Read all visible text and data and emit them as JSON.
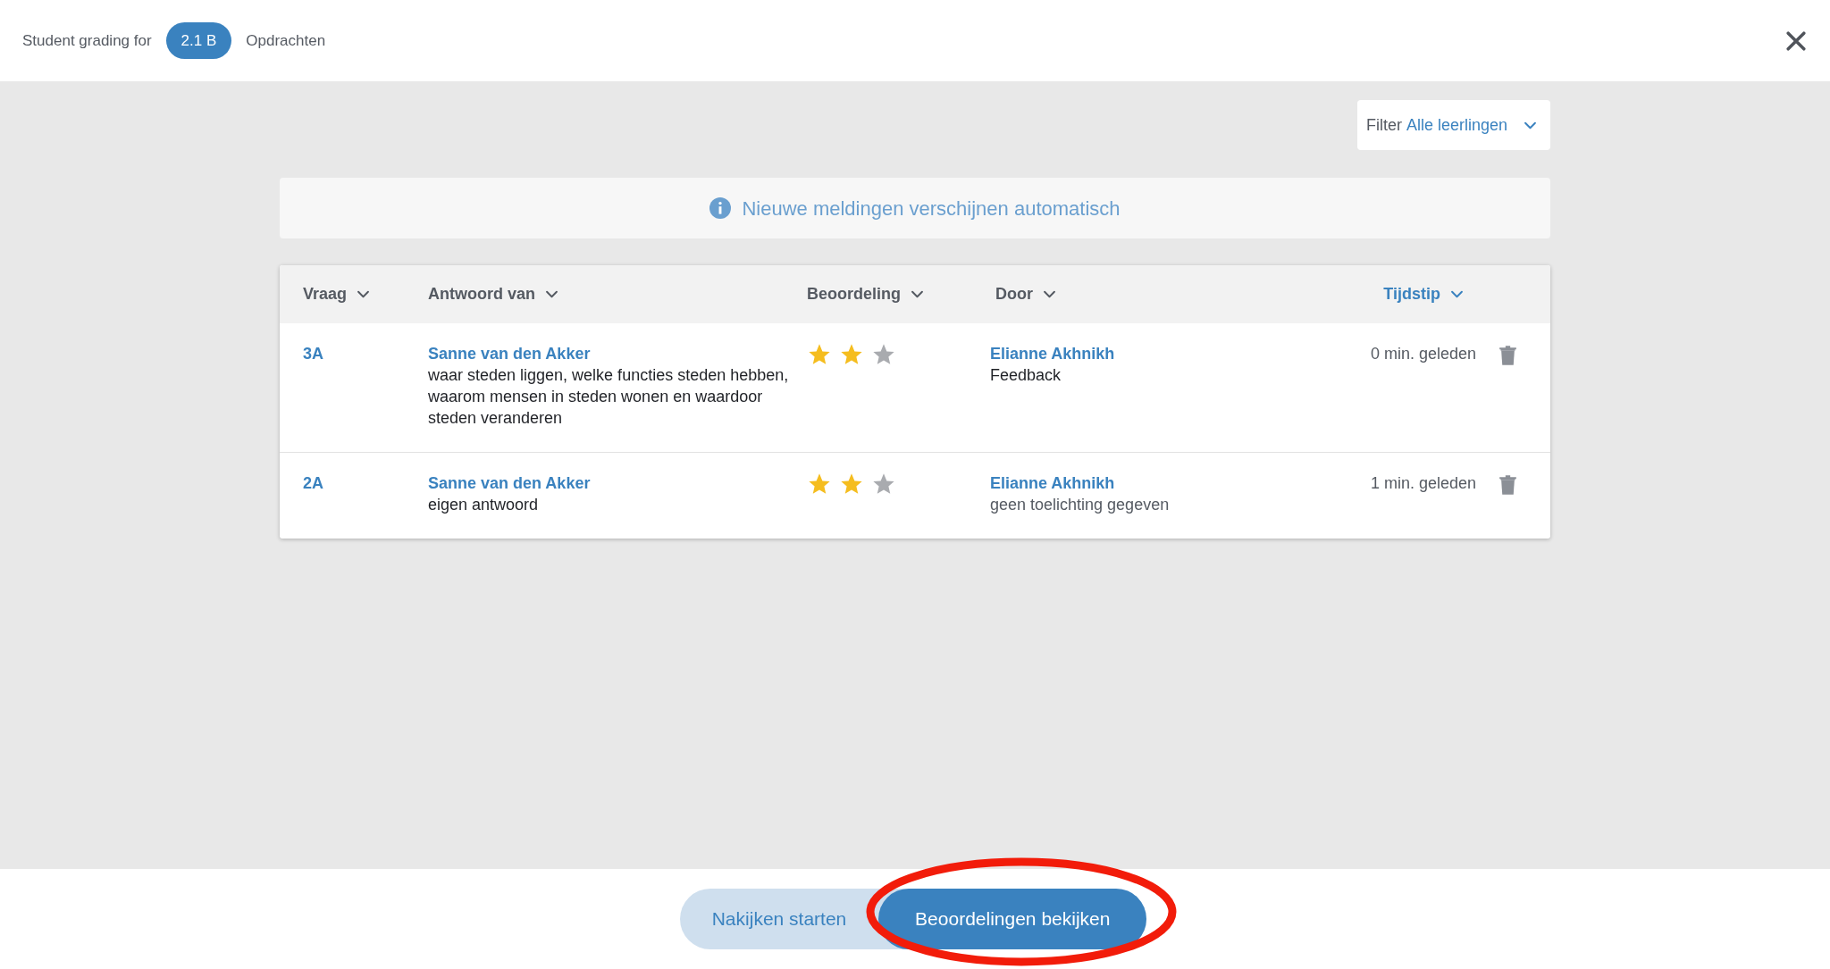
{
  "header": {
    "title": "Student grading for",
    "class_badge": "2.1 B",
    "section": "Opdrachten"
  },
  "filter": {
    "label": "Filter",
    "value": "Alle leerlingen"
  },
  "notice": "Nieuwe meldingen verschijnen automatisch",
  "table": {
    "columns": [
      {
        "label": "Vraag",
        "selected": false
      },
      {
        "label": "Antwoord van",
        "selected": false
      },
      {
        "label": "Beoordeling",
        "selected": false
      },
      {
        "label": "Door",
        "selected": false
      },
      {
        "label": "Tijdstip",
        "selected": true
      }
    ],
    "rows": [
      {
        "question": "3A",
        "student": "Sanne van den Akker",
        "answer": "waar steden liggen, welke functies steden hebben, waarom mensen in steden wonen en waardoor steden veranderen",
        "stars": 2,
        "grader": "Elianne Akhnikh",
        "comment": "Feedback",
        "comment_muted": false,
        "time": "0 min. geleden"
      },
      {
        "question": "2A",
        "student": "Sanne van den Akker",
        "answer": "eigen antwoord",
        "stars": 2,
        "grader": "Elianne Akhnikh",
        "comment": "geen toelichting gegeven",
        "comment_muted": true,
        "time": "1 min. geleden"
      }
    ]
  },
  "footer_buttons": [
    {
      "label": "Nakijken starten",
      "kind": "secondary"
    },
    {
      "label": "Beoordelingen bekijken",
      "kind": "primary"
    }
  ]
}
